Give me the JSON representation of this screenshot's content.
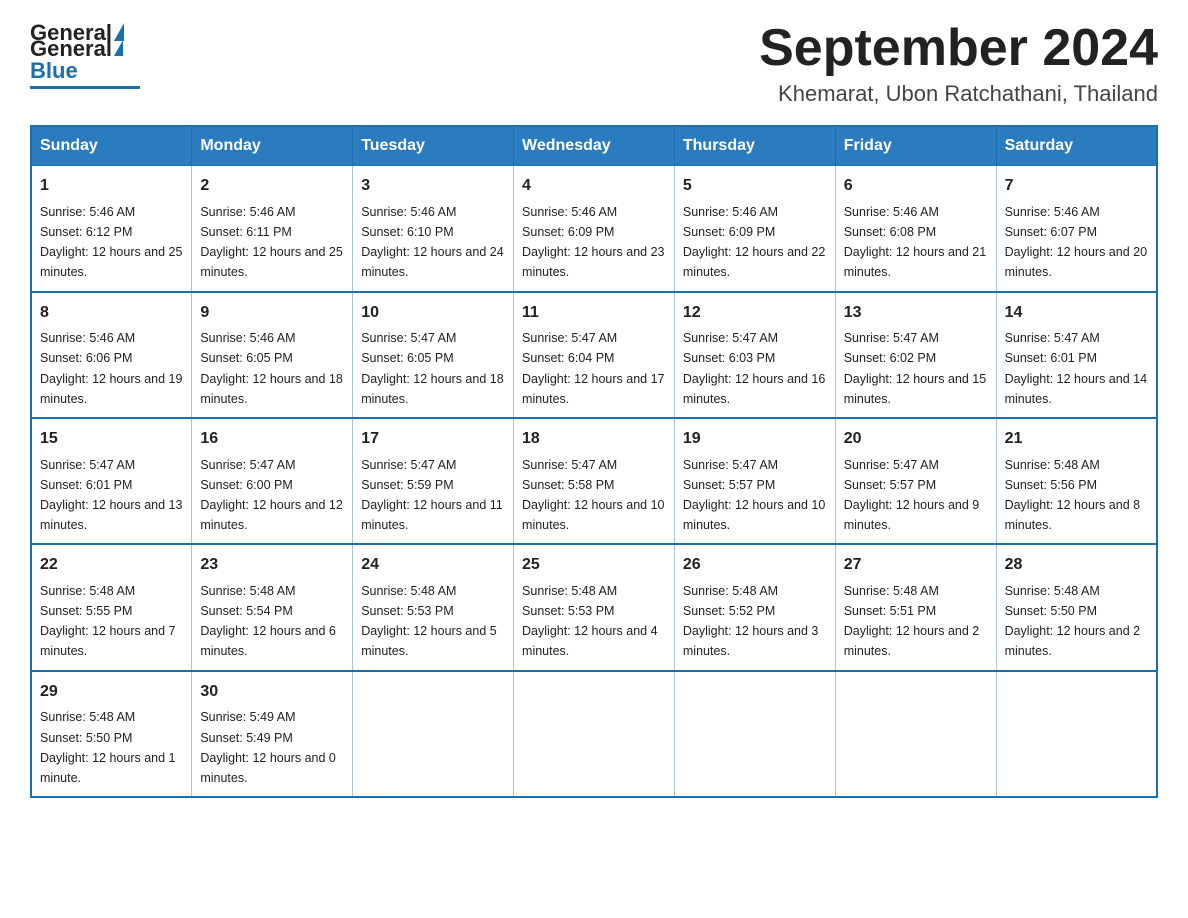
{
  "header": {
    "logo_general": "General",
    "logo_blue": "Blue",
    "month_title": "September 2024",
    "location": "Khemarat, Ubon Ratchathani, Thailand"
  },
  "days_of_week": [
    "Sunday",
    "Monday",
    "Tuesday",
    "Wednesday",
    "Thursday",
    "Friday",
    "Saturday"
  ],
  "weeks": [
    [
      {
        "day": 1,
        "sunrise": "5:46 AM",
        "sunset": "6:12 PM",
        "daylight": "12 hours and 25 minutes."
      },
      {
        "day": 2,
        "sunrise": "5:46 AM",
        "sunset": "6:11 PM",
        "daylight": "12 hours and 25 minutes."
      },
      {
        "day": 3,
        "sunrise": "5:46 AM",
        "sunset": "6:10 PM",
        "daylight": "12 hours and 24 minutes."
      },
      {
        "day": 4,
        "sunrise": "5:46 AM",
        "sunset": "6:09 PM",
        "daylight": "12 hours and 23 minutes."
      },
      {
        "day": 5,
        "sunrise": "5:46 AM",
        "sunset": "6:09 PM",
        "daylight": "12 hours and 22 minutes."
      },
      {
        "day": 6,
        "sunrise": "5:46 AM",
        "sunset": "6:08 PM",
        "daylight": "12 hours and 21 minutes."
      },
      {
        "day": 7,
        "sunrise": "5:46 AM",
        "sunset": "6:07 PM",
        "daylight": "12 hours and 20 minutes."
      }
    ],
    [
      {
        "day": 8,
        "sunrise": "5:46 AM",
        "sunset": "6:06 PM",
        "daylight": "12 hours and 19 minutes."
      },
      {
        "day": 9,
        "sunrise": "5:46 AM",
        "sunset": "6:05 PM",
        "daylight": "12 hours and 18 minutes."
      },
      {
        "day": 10,
        "sunrise": "5:47 AM",
        "sunset": "6:05 PM",
        "daylight": "12 hours and 18 minutes."
      },
      {
        "day": 11,
        "sunrise": "5:47 AM",
        "sunset": "6:04 PM",
        "daylight": "12 hours and 17 minutes."
      },
      {
        "day": 12,
        "sunrise": "5:47 AM",
        "sunset": "6:03 PM",
        "daylight": "12 hours and 16 minutes."
      },
      {
        "day": 13,
        "sunrise": "5:47 AM",
        "sunset": "6:02 PM",
        "daylight": "12 hours and 15 minutes."
      },
      {
        "day": 14,
        "sunrise": "5:47 AM",
        "sunset": "6:01 PM",
        "daylight": "12 hours and 14 minutes."
      }
    ],
    [
      {
        "day": 15,
        "sunrise": "5:47 AM",
        "sunset": "6:01 PM",
        "daylight": "12 hours and 13 minutes."
      },
      {
        "day": 16,
        "sunrise": "5:47 AM",
        "sunset": "6:00 PM",
        "daylight": "12 hours and 12 minutes."
      },
      {
        "day": 17,
        "sunrise": "5:47 AM",
        "sunset": "5:59 PM",
        "daylight": "12 hours and 11 minutes."
      },
      {
        "day": 18,
        "sunrise": "5:47 AM",
        "sunset": "5:58 PM",
        "daylight": "12 hours and 10 minutes."
      },
      {
        "day": 19,
        "sunrise": "5:47 AM",
        "sunset": "5:57 PM",
        "daylight": "12 hours and 10 minutes."
      },
      {
        "day": 20,
        "sunrise": "5:47 AM",
        "sunset": "5:57 PM",
        "daylight": "12 hours and 9 minutes."
      },
      {
        "day": 21,
        "sunrise": "5:48 AM",
        "sunset": "5:56 PM",
        "daylight": "12 hours and 8 minutes."
      }
    ],
    [
      {
        "day": 22,
        "sunrise": "5:48 AM",
        "sunset": "5:55 PM",
        "daylight": "12 hours and 7 minutes."
      },
      {
        "day": 23,
        "sunrise": "5:48 AM",
        "sunset": "5:54 PM",
        "daylight": "12 hours and 6 minutes."
      },
      {
        "day": 24,
        "sunrise": "5:48 AM",
        "sunset": "5:53 PM",
        "daylight": "12 hours and 5 minutes."
      },
      {
        "day": 25,
        "sunrise": "5:48 AM",
        "sunset": "5:53 PM",
        "daylight": "12 hours and 4 minutes."
      },
      {
        "day": 26,
        "sunrise": "5:48 AM",
        "sunset": "5:52 PM",
        "daylight": "12 hours and 3 minutes."
      },
      {
        "day": 27,
        "sunrise": "5:48 AM",
        "sunset": "5:51 PM",
        "daylight": "12 hours and 2 minutes."
      },
      {
        "day": 28,
        "sunrise": "5:48 AM",
        "sunset": "5:50 PM",
        "daylight": "12 hours and 2 minutes."
      }
    ],
    [
      {
        "day": 29,
        "sunrise": "5:48 AM",
        "sunset": "5:50 PM",
        "daylight": "12 hours and 1 minute."
      },
      {
        "day": 30,
        "sunrise": "5:49 AM",
        "sunset": "5:49 PM",
        "daylight": "12 hours and 0 minutes."
      },
      null,
      null,
      null,
      null,
      null
    ]
  ]
}
